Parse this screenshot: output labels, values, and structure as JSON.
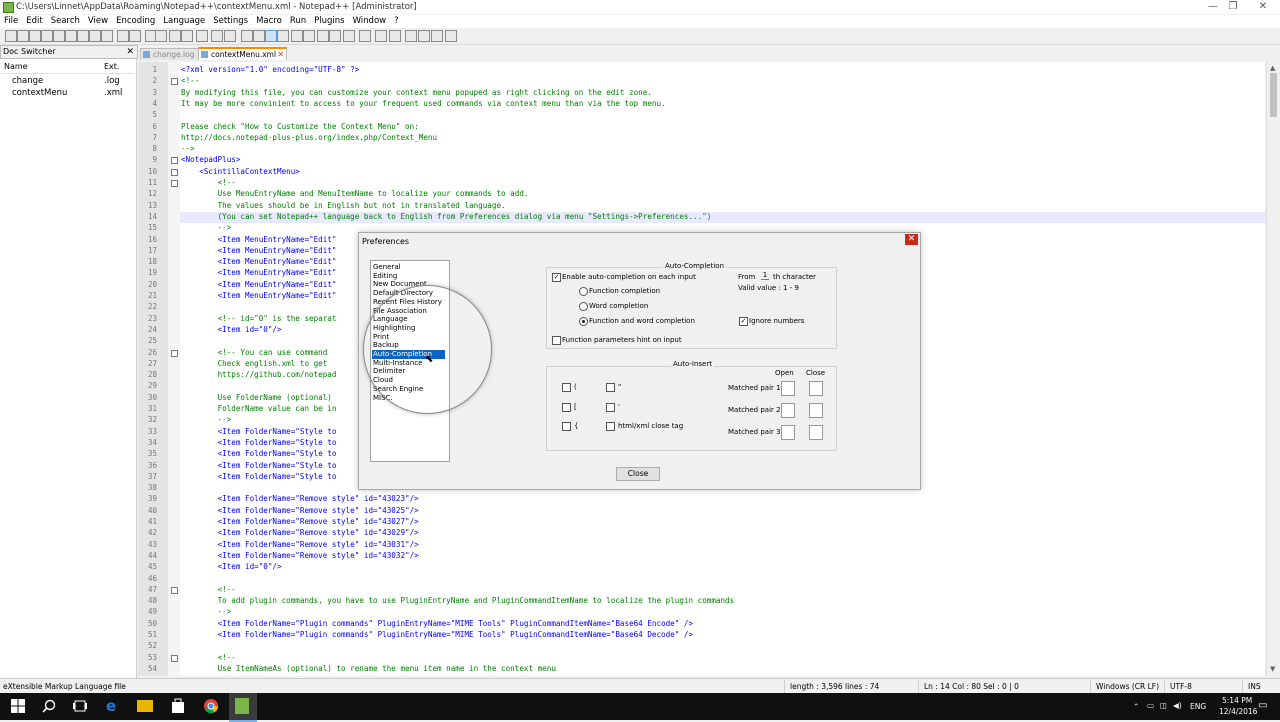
{
  "window": {
    "title": "C:\\Users\\Linnet\\AppData\\Roaming\\Notepad++\\contextMenu.xml - Notepad++ [Administrator]",
    "controls": {
      "minimize": "—",
      "maximize": "❐",
      "close": "✕"
    }
  },
  "menu": [
    "File",
    "Edit",
    "Search",
    "View",
    "Encoding",
    "Language",
    "Settings",
    "Macro",
    "Run",
    "Plugins",
    "Window",
    "?"
  ],
  "toolbar": {
    "icon_count": 34
  },
  "doc_switcher": {
    "title": "Doc Switcher",
    "close": "✕",
    "col_name": "Name",
    "col_ext": "Ext.",
    "items": [
      {
        "name": "change",
        "ext": ".log"
      },
      {
        "name": "contextMenu",
        "ext": ".xml"
      }
    ]
  },
  "tabs": [
    {
      "label": "change.log",
      "active": false,
      "close": ""
    },
    {
      "label": "contextMenu.xml",
      "active": true,
      "close": "✕"
    }
  ],
  "editor": {
    "lines": [
      {
        "n": "1",
        "text": "<?xml version=\"1.0\" encoding=\"UTF-8\" ?>",
        "style": "blue"
      },
      {
        "n": "2",
        "text": "<!--",
        "style": "green"
      },
      {
        "n": "3",
        "text": "By modifying this file, you can customize your context menu popuped as right clicking on the edit zone.",
        "style": "green"
      },
      {
        "n": "4",
        "text": "It may be more convinient to access to your frequent used commands via context menu than via the top menu.",
        "style": "green"
      },
      {
        "n": "5",
        "text": "",
        "style": "green"
      },
      {
        "n": "6",
        "text": "Please check \"How to Customize the Context Menu\" on:",
        "style": "green"
      },
      {
        "n": "7",
        "text": "http://docs.notepad-plus-plus.org/index.php/Context_Menu",
        "style": "green"
      },
      {
        "n": "8",
        "text": "-->",
        "style": "green"
      },
      {
        "n": "9",
        "text": "<NotepadPlus>",
        "style": "tag"
      },
      {
        "n": "10",
        "text": "    <ScintillaContextMenu>",
        "style": "tag"
      },
      {
        "n": "11",
        "text": "        <!--",
        "style": "green"
      },
      {
        "n": "12",
        "text": "        Use MenuEntryName and MenuItemName to localize your commands to add.",
        "style": "green"
      },
      {
        "n": "13",
        "text": "        The values should be in English but not in translated language.",
        "style": "green"
      },
      {
        "n": "14",
        "text": "        (You can set Notepad++ language back to English from Preferences dialog via menu \"Settings->Preferences...\")",
        "style": "green"
      },
      {
        "n": "15",
        "text": "        -->",
        "style": "green"
      },
      {
        "n": "16",
        "text": "        <Item MenuEntryName=\"Edit\"",
        "style": "tag"
      },
      {
        "n": "17",
        "text": "        <Item MenuEntryName=\"Edit\"",
        "style": "tag"
      },
      {
        "n": "18",
        "text": "        <Item MenuEntryName=\"Edit\"",
        "style": "tag"
      },
      {
        "n": "19",
        "text": "        <Item MenuEntryName=\"Edit\"",
        "style": "tag"
      },
      {
        "n": "20",
        "text": "        <Item MenuEntryName=\"Edit\"",
        "style": "tag"
      },
      {
        "n": "21",
        "text": "        <Item MenuEntryName=\"Edit\"",
        "style": "tag"
      },
      {
        "n": "22",
        "text": "",
        "style": "green"
      },
      {
        "n": "23",
        "text": "        <!-- id=\"0\" is the separat",
        "style": "green"
      },
      {
        "n": "24",
        "text": "        <Item id=\"0\"/>",
        "style": "tag"
      },
      {
        "n": "25",
        "text": "",
        "style": "green"
      },
      {
        "n": "26",
        "text": "        <!-- You can use command",
        "style": "green"
      },
      {
        "n": "27",
        "text": "        Check english.xml to get",
        "style": "green"
      },
      {
        "n": "28",
        "text": "        https://github.com/notepad",
        "style": "green"
      },
      {
        "n": "29",
        "text": "",
        "style": "green"
      },
      {
        "n": "30",
        "text": "        Use FolderName (optional)",
        "style": "green"
      },
      {
        "n": "31",
        "text": "        FolderName value can be in",
        "style": "green"
      },
      {
        "n": "32",
        "text": "        -->",
        "style": "green"
      },
      {
        "n": "33",
        "text": "        <Item FolderName=\"Style to",
        "style": "tag"
      },
      {
        "n": "34",
        "text": "        <Item FolderName=\"Style to",
        "style": "tag"
      },
      {
        "n": "35",
        "text": "        <Item FolderName=\"Style to",
        "style": "tag"
      },
      {
        "n": "36",
        "text": "        <Item FolderName=\"Style to",
        "style": "tag"
      },
      {
        "n": "37",
        "text": "        <Item FolderName=\"Style to",
        "style": "tag"
      },
      {
        "n": "38",
        "text": "",
        "style": "green"
      },
      {
        "n": "39",
        "text": "        <Item FolderName=\"Remove style\" id=\"43023\"/>",
        "style": "tag"
      },
      {
        "n": "40",
        "text": "        <Item FolderName=\"Remove style\" id=\"43025\"/>",
        "style": "tag"
      },
      {
        "n": "41",
        "text": "        <Item FolderName=\"Remove style\" id=\"43027\"/>",
        "style": "tag"
      },
      {
        "n": "42",
        "text": "        <Item FolderName=\"Remove style\" id=\"43029\"/>",
        "style": "tag"
      },
      {
        "n": "43",
        "text": "        <Item FolderName=\"Remove style\" id=\"43031\"/>",
        "style": "tag"
      },
      {
        "n": "44",
        "text": "        <Item FolderName=\"Remove style\" id=\"43032\"/>",
        "style": "tag"
      },
      {
        "n": "45",
        "text": "        <Item id=\"0\"/>",
        "style": "tag"
      },
      {
        "n": "46",
        "text": "",
        "style": "green"
      },
      {
        "n": "47",
        "text": "        <!--",
        "style": "green"
      },
      {
        "n": "48",
        "text": "        To add plugin commands, you have to use PluginEntryName and PluginCommandItemName to localize the plugin commands",
        "style": "green"
      },
      {
        "n": "49",
        "text": "        -->",
        "style": "green"
      },
      {
        "n": "50",
        "text": "        <Item FolderName=\"Plugin commands\" PluginEntryName=\"MIME Tools\" PluginCommandItemName=\"Base64 Encode\" />",
        "style": "tag"
      },
      {
        "n": "51",
        "text": "        <Item FolderName=\"Plugin commands\" PluginEntryName=\"MIME Tools\" PluginCommandItemName=\"Base64 Decode\" />",
        "style": "tag"
      },
      {
        "n": "52",
        "text": "",
        "style": "green"
      },
      {
        "n": "53",
        "text": "        <!--",
        "style": "green"
      },
      {
        "n": "54",
        "text": "        Use ItemNameAs (optional) to rename the menu item name in the context menu",
        "style": "green"
      }
    ]
  },
  "preferences": {
    "title": "Preferences",
    "close": "✕",
    "categories": [
      "General",
      "Editing",
      "New Document",
      "Default Directory",
      "Recent Files History",
      "File Association",
      "Language",
      "Highlighting",
      "Print",
      "Backup",
      "Auto-Completion",
      "Multi-Instance",
      "Delimiter",
      "Cloud",
      "Search Engine",
      "MISC."
    ],
    "selected": "Auto-Completion",
    "autocompletion": {
      "group_title": "Auto-Completion",
      "enable_label": "Enable auto-completion on each input",
      "enable_checked": true,
      "from_label": "From",
      "from_value": "1",
      "from_suffix": "th character",
      "valid_value": "Valid value : 1 - 9",
      "opt_function": "Function completion",
      "opt_word": "Word completion",
      "opt_both": "Function and word completion",
      "ignore_numbers": "Ignore numbers",
      "ignore_checked": true,
      "param_hint": "Function parameters hint on input",
      "check_mark": "✓"
    },
    "autoinsert": {
      "group_title": "Auto-Insert",
      "open": "Open",
      "close": "Close",
      "paren": "(",
      "bracket": "[",
      "brace": "{",
      "dquote": "\"",
      "squote": "'",
      "html_close": "html/xml close tag",
      "pair1": "Matched pair 1:",
      "pair2": "Matched pair 2:",
      "pair3": "Matched pair 3:"
    },
    "close_button": "Close"
  },
  "statusbar": {
    "lang": "eXtensible Markup Language file",
    "length": "length : 3,596",
    "lines": "lines : 74",
    "pos": "Ln : 14   Col : 80   Sel : 0 | 0",
    "eol": "Windows (CR LF)",
    "enc": "UTF-8",
    "mode": "INS"
  },
  "taskbar": {
    "lang": "ENG",
    "time": "5:14 PM",
    "date": "12/4/2016",
    "start_icon": "windows-logo",
    "colors": {
      "edge": "#1e7ad8",
      "chrome": "#e8b500",
      "notepad": "#7ab648"
    }
  }
}
